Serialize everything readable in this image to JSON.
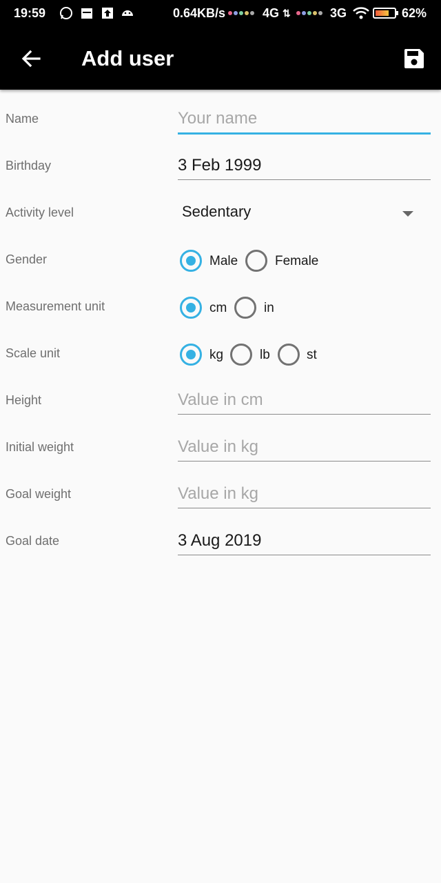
{
  "status_bar": {
    "time": "19:59",
    "speed": "0.64KB/s",
    "net1": "4G",
    "net2": "3G",
    "battery": "62%",
    "icons": [
      "whatsapp-icon",
      "calendar-icon",
      "upload-icon",
      "android-icon",
      "wifi-icon",
      "battery-icon"
    ]
  },
  "toolbar": {
    "title": "Add user",
    "back_icon": "arrow-back-icon",
    "save_icon": "save-floppy-icon"
  },
  "colors": {
    "accent": "#35b1e3",
    "toolbar_bg": "#000000",
    "page_bg": "#fafafa"
  },
  "form": {
    "name": {
      "label": "Name",
      "value": "",
      "placeholder": "Your name"
    },
    "birthday": {
      "label": "Birthday",
      "value": "3 Feb 1999"
    },
    "activity": {
      "label": "Activity level",
      "selected": "Sedentary"
    },
    "gender": {
      "label": "Gender",
      "options": [
        "Male",
        "Female"
      ],
      "selected": "Male"
    },
    "measurement_unit": {
      "label": "Measurement unit",
      "options": [
        "cm",
        "in"
      ],
      "selected": "cm"
    },
    "scale_unit": {
      "label": "Scale unit",
      "options": [
        "kg",
        "lb",
        "st"
      ],
      "selected": "kg"
    },
    "height": {
      "label": "Height",
      "value": "",
      "placeholder": "Value in cm"
    },
    "initial_weight": {
      "label": "Initial weight",
      "value": "",
      "placeholder": "Value in kg"
    },
    "goal_weight": {
      "label": "Goal weight",
      "value": "",
      "placeholder": "Value in kg"
    },
    "goal_date": {
      "label": "Goal date",
      "value": "3 Aug 2019"
    }
  }
}
